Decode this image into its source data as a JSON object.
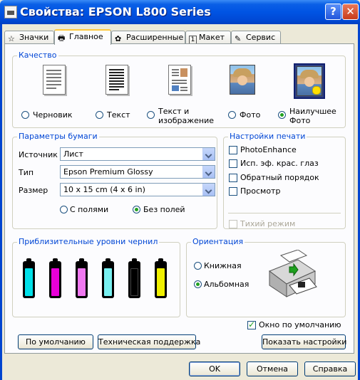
{
  "window": {
    "title": "Свойства: EPSON L800 Series",
    "help_glyph": "?",
    "close_glyph": "✕"
  },
  "tabs": [
    {
      "label": "Значки",
      "icon": "star-icon",
      "glyph": "☆"
    },
    {
      "label": "Главное",
      "icon": "printer-icon",
      "glyph": "🖶"
    },
    {
      "label": "Расширенные",
      "icon": "settings-icon",
      "glyph": "✿"
    },
    {
      "label": "Макет",
      "icon": "layout-icon",
      "glyph": "1"
    },
    {
      "label": "Сервис",
      "icon": "wrench-icon",
      "glyph": "✎"
    }
  ],
  "quality": {
    "legend": "Качество",
    "options": [
      {
        "label": "Черновик",
        "selected": false
      },
      {
        "label": "Текст",
        "selected": false
      },
      {
        "label": "Текст и\nизображение",
        "line1": "Текст и",
        "line2": "изображение",
        "selected": false
      },
      {
        "label": "Фото",
        "selected": false
      },
      {
        "label": "Наилучшее Фото",
        "line1": "Наилучшее",
        "line2": "Фото",
        "selected": true
      }
    ]
  },
  "paper": {
    "legend": "Параметры бумаги",
    "source_label": "Источник",
    "source_value": "Лист",
    "type_label": "Тип",
    "type_value": "Epson Premium Glossy",
    "size_label": "Размер",
    "size_value": "10 x 15 cm (4 x 6 in)",
    "border_label": "С полями",
    "borderless_label": "Без полей",
    "borderless_selected": true
  },
  "print_settings": {
    "legend": "Настройки печати",
    "photoenhance": "PhotoEnhance",
    "red_eye": "Исп. эф. крас. глаз",
    "reverse_order": "Обратный порядок",
    "preview": "Просмотр",
    "quiet_mode": "Тихий режим"
  },
  "ink": {
    "legend": "Приблизительные уровни чернил",
    "colors": [
      "#00e0e8",
      "#e800d8",
      "#f078f0",
      "#78f0f0",
      "#000000",
      "#f0f000"
    ],
    "levels": [
      0.85,
      0.85,
      0.85,
      0.85,
      0.85,
      0.85
    ]
  },
  "orientation": {
    "legend": "Ориентация",
    "portrait": "Книжная",
    "landscape": "Альбомная",
    "landscape_selected": true
  },
  "default_window": {
    "label": "Окно по умолчанию",
    "checked": true
  },
  "buttons": {
    "defaults": "По умолчанию",
    "support": "Техническая поддержка",
    "show_settings": "Показать настройки",
    "ok": "OK",
    "cancel": "Отмена",
    "help": "Справка"
  }
}
